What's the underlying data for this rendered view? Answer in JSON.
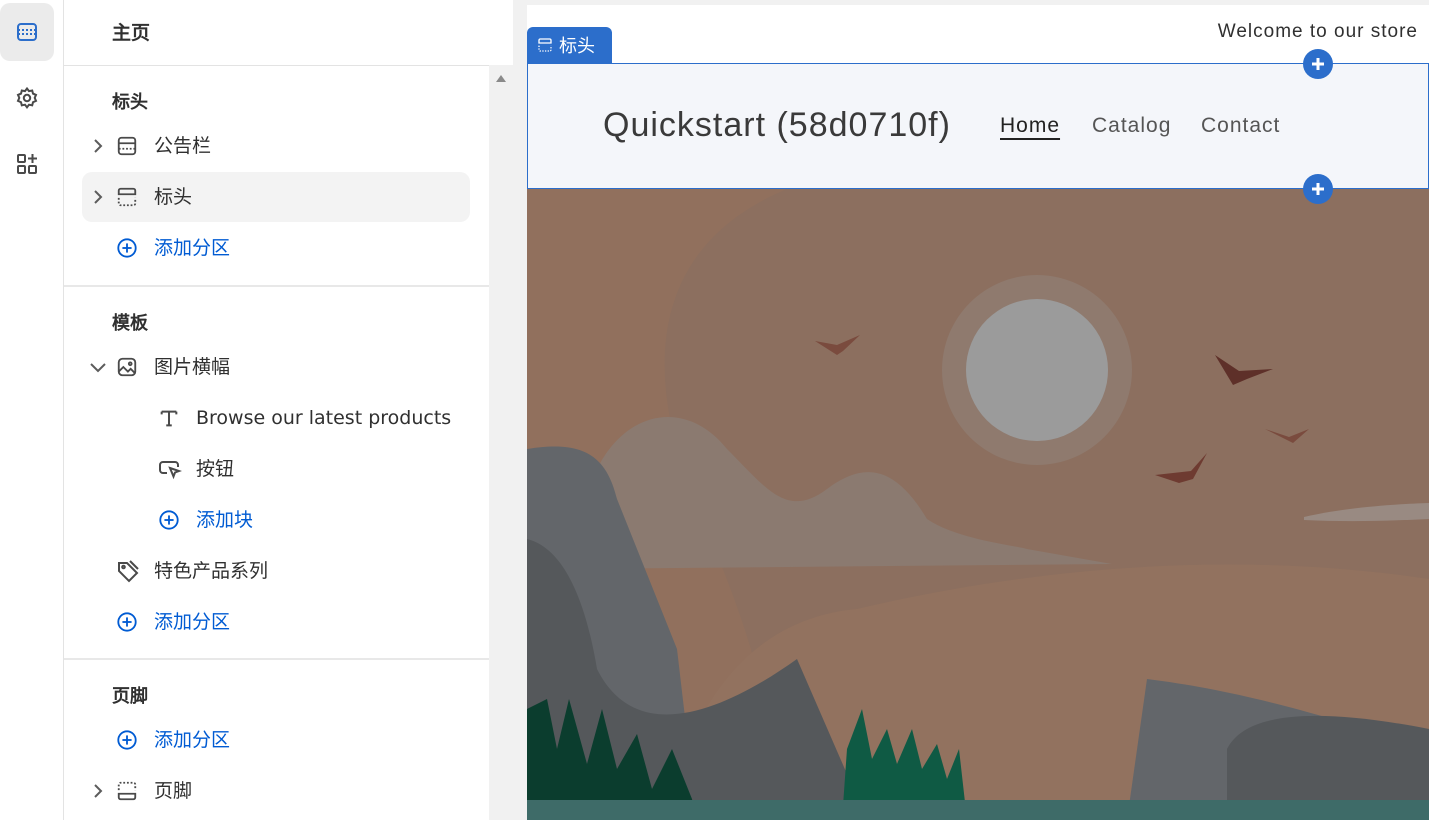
{
  "rail": {
    "items": [
      {
        "name": "sections-icon",
        "active": true
      },
      {
        "name": "settings-icon",
        "active": false
      },
      {
        "name": "apps-icon",
        "active": false
      }
    ]
  },
  "panel": {
    "title": "主页",
    "groups": {
      "header": {
        "title": "标头",
        "items": [
          "公告栏",
          "标头"
        ],
        "add_label": "添加分区"
      },
      "template": {
        "title": "模板",
        "section": "图片横幅",
        "blocks": [
          "Browse our latest products",
          "按钮"
        ],
        "add_block_label": "添加块",
        "section2": "特色产品系列",
        "add_label": "添加分区"
      },
      "footer": {
        "title": "页脚",
        "add_label": "添加分区",
        "items": [
          "页脚"
        ]
      }
    }
  },
  "preview": {
    "announcement": "Welcome to our store",
    "selected_tag": "标头",
    "logo": "Quickstart (58d0710f)",
    "nav": [
      "Home",
      "Catalog",
      "Contact"
    ]
  },
  "colors": {
    "accent": "#2c6ecb",
    "link": "#005bd3",
    "banner_sky": "#8c6f5f"
  }
}
